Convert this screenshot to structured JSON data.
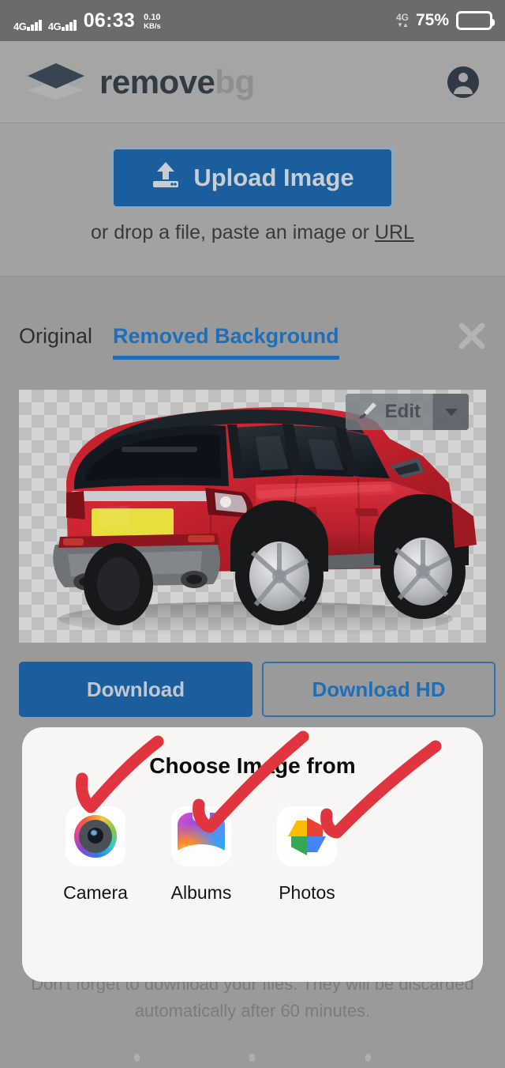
{
  "status_bar": {
    "sim1_network": "4G",
    "sim2_network": "4G",
    "time": "06:33",
    "net_speed_value": "0.10",
    "net_speed_unit": "KB/s",
    "right_network": "4G",
    "battery_percent": "75%"
  },
  "header": {
    "brand_primary": "remove",
    "brand_secondary": "bg",
    "account_icon": "account-circle-icon"
  },
  "upload": {
    "button_label": "Upload Image",
    "button_icon": "upload-icon",
    "hint_prefix": "or drop a file, paste an image or ",
    "hint_link": "URL"
  },
  "result": {
    "tabs": [
      {
        "label": "Original",
        "active": false
      },
      {
        "label": "Removed Background",
        "active": true
      }
    ],
    "close_icon": "close-icon",
    "edit_label": "Edit",
    "edit_icon": "brush-icon",
    "edit_caret_icon": "chevron-down-icon",
    "image_alt": "red range rover evoque rear three-quarter view on transparent checkerboard",
    "download_label": "Download",
    "download_hd_label": "Download HD"
  },
  "footer": {
    "note_line1": "Don't forget to download your files. They will be discarded",
    "note_line2": "automatically after 60 minutes."
  },
  "sheet": {
    "title": "Choose Image from",
    "items": [
      {
        "label": "Camera",
        "icon": "camera-app-icon"
      },
      {
        "label": "Albums",
        "icon": "albums-app-icon"
      },
      {
        "label": "Photos",
        "icon": "google-photos-app-icon"
      }
    ]
  },
  "annotations": {
    "stroke_color": "#e0343f",
    "marks": [
      {
        "name": "red-check-camera"
      },
      {
        "name": "red-check-albums"
      },
      {
        "name": "red-check-photos"
      }
    ]
  },
  "colors": {
    "page_background": "#9a9a9a",
    "status_bar": "#6b6b6b",
    "primary_blue": "#1a5e9e",
    "tab_active_blue": "#1f6fb8",
    "logo_dark": "#303b44",
    "sheet_background": "#f7f6f4"
  }
}
